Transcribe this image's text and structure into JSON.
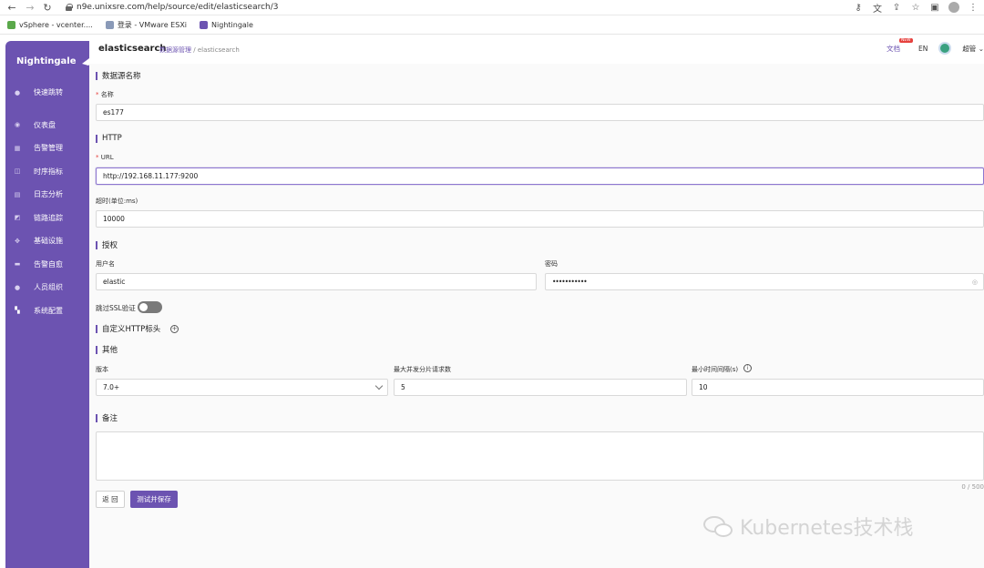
{
  "browser": {
    "url": "n9e.unixsre.com/help/source/edit/elasticsearch/3",
    "bookmarks": [
      {
        "label": "vSphere - vcenter....",
        "color": "#5aa84a"
      },
      {
        "label": "登录 - VMware ESXi",
        "color": "#8a9ab8"
      },
      {
        "label": "Nightingale",
        "color": "#6c53b1"
      }
    ]
  },
  "sidebar": {
    "logo": "Nightingale",
    "items": [
      {
        "label": "快速跳转",
        "icon": "search-icon"
      },
      {
        "label": "仪表盘",
        "icon": "dashboard-icon"
      },
      {
        "label": "告警管理",
        "icon": "alarm-icon"
      },
      {
        "label": "时序指标",
        "icon": "metrics-icon"
      },
      {
        "label": "日志分析",
        "icon": "log-icon"
      },
      {
        "label": "链路追踪",
        "icon": "trace-icon"
      },
      {
        "label": "基础设施",
        "icon": "infra-icon"
      },
      {
        "label": "告警自愈",
        "icon": "heal-icon"
      },
      {
        "label": "人员组织",
        "icon": "user-icon"
      },
      {
        "label": "系统配置",
        "icon": "settings-icon"
      }
    ]
  },
  "header": {
    "title": "elasticsearch",
    "breadcrumb_link": "数据源管理",
    "breadcrumb_sep": " / ",
    "breadcrumb_current": "elasticsearch",
    "doc_label": "文档",
    "new_badge": "NEW",
    "lang": "EN",
    "user": "超管"
  },
  "form": {
    "section_name": "数据源名称",
    "name_label": "名称",
    "name_value": "es177",
    "section_http": "HTTP",
    "url_label": "URL",
    "url_value": "http://192.168.11.177:9200",
    "timeout_label": "超时(单位:ms)",
    "timeout_value": "10000",
    "section_auth": "授权",
    "username_label": "用户名",
    "username_value": "elastic",
    "password_label": "密码",
    "password_value": "•••••••••••",
    "skip_ssl_label": "跳过SSL验证",
    "skip_ssl_on": false,
    "section_headers": "自定义HTTP标头",
    "section_other": "其他",
    "version_label": "版本",
    "version_value": "7.0+",
    "max_shard_label": "最大并发分片请求数",
    "max_shard_value": "5",
    "min_interval_label": "最小时间间隔(s)",
    "min_interval_value": "10",
    "section_note": "备注",
    "note_counter": "0 / 500",
    "back_button": "返 回",
    "save_button": "测试并保存"
  },
  "watermark": "Kubernetes技术栈"
}
